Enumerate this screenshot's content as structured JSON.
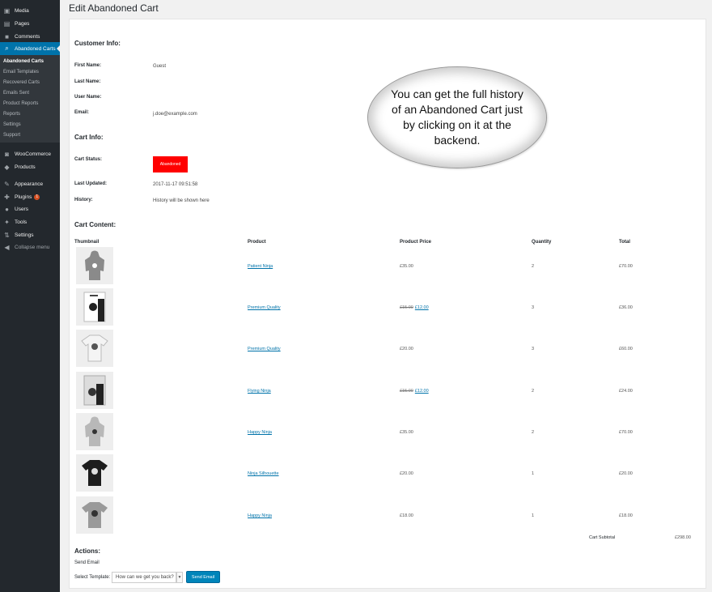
{
  "sidebar": {
    "top_items": [
      {
        "label": "Media",
        "icon": "media-icon"
      },
      {
        "label": "Pages",
        "icon": "pages-icon"
      },
      {
        "label": "Comments",
        "icon": "comments-icon"
      }
    ],
    "active_item": {
      "label": "Abandoned Carts",
      "icon": "cart-icon"
    },
    "submenu": [
      {
        "label": "Abandoned Carts",
        "current": true
      },
      {
        "label": "Email Templates"
      },
      {
        "label": "Recovered Carts"
      },
      {
        "label": "Emails Sent"
      },
      {
        "label": "Product Reports"
      },
      {
        "label": "Reports"
      },
      {
        "label": "Settings"
      },
      {
        "label": "Support"
      }
    ],
    "bottom_items": [
      {
        "label": "WooCommerce",
        "icon": "woocommerce-icon"
      },
      {
        "label": "Products",
        "icon": "products-icon"
      },
      {
        "label": "Appearance",
        "icon": "appearance-icon"
      },
      {
        "label": "Plugins",
        "icon": "plugins-icon",
        "badge": "1"
      },
      {
        "label": "Users",
        "icon": "users-icon"
      },
      {
        "label": "Tools",
        "icon": "tools-icon"
      },
      {
        "label": "Settings",
        "icon": "settings-icon"
      },
      {
        "label": "Collapse menu",
        "icon": "collapse-icon"
      }
    ]
  },
  "page": {
    "title": "Edit Abandoned Cart"
  },
  "customer_info": {
    "title": "Customer Info:",
    "first_name_label": "First Name:",
    "first_name": "Guest",
    "last_name_label": "Last Name:",
    "user_name_label": "User Name:",
    "email_label": "Email:",
    "email": "j.doe@example.com"
  },
  "cart_info": {
    "title": "Cart Info:",
    "status_label": "Cart Status:",
    "status": "Abandoned",
    "status_color": "#ff0000",
    "updated_label": "Last Updated:",
    "updated": "2017-11-17 09:51:58",
    "history_label": "History:",
    "history": "History will be shown here"
  },
  "callout": {
    "text": "You can get the full history of an Abandoned Cart just by clicking on it at the backend."
  },
  "cart_content": {
    "title": "Cart Content:",
    "headers": [
      "Thumbnail",
      "Product",
      "Product Price",
      "Quantity",
      "Total"
    ],
    "rows": [
      {
        "thumb": "hoodie-icon",
        "thumb_color": "#8a8a8a",
        "product": "Patient Ninja",
        "price": "£35.00",
        "old_price": "",
        "qty": "2",
        "total": "£70.00"
      },
      {
        "thumb": "poster-icon",
        "thumb_color": "#ffffff",
        "product": "Premium Quality",
        "price": "£12.00",
        "old_price": "£15.00",
        "qty": "3",
        "total": "£36.00"
      },
      {
        "thumb": "tshirt-icon",
        "thumb_color": "#f4f4f4",
        "product": "Premium Quality",
        "price": "£20.00",
        "old_price": "",
        "qty": "3",
        "total": "£60.00"
      },
      {
        "thumb": "poster-icon",
        "thumb_color": "#dcdcdc",
        "product": "Flying Ninja",
        "price": "£12.00",
        "old_price": "£15.00",
        "qty": "2",
        "total": "£24.00"
      },
      {
        "thumb": "hoodie-icon",
        "thumb_color": "#b8b8b8",
        "product": "Happy Ninja",
        "price": "£35.00",
        "old_price": "",
        "qty": "2",
        "total": "£70.00"
      },
      {
        "thumb": "tshirt-icon",
        "thumb_color": "#1d1d1d",
        "product": "Ninja Silhouette",
        "price": "£20.00",
        "old_price": "",
        "qty": "1",
        "total": "£20.00"
      },
      {
        "thumb": "tshirt-icon",
        "thumb_color": "#9a9a9a",
        "product": "Happy Ninja",
        "price": "£18.00",
        "old_price": "",
        "qty": "1",
        "total": "£18.00"
      }
    ],
    "subtotal_label": "Cart Subtotal",
    "subtotal": "£298.00"
  },
  "actions": {
    "title": "Actions:",
    "send_email_label": "Send Email",
    "template_label": "Select Template:",
    "template_value": "How can we get you back?",
    "button_label": "Send Email"
  }
}
